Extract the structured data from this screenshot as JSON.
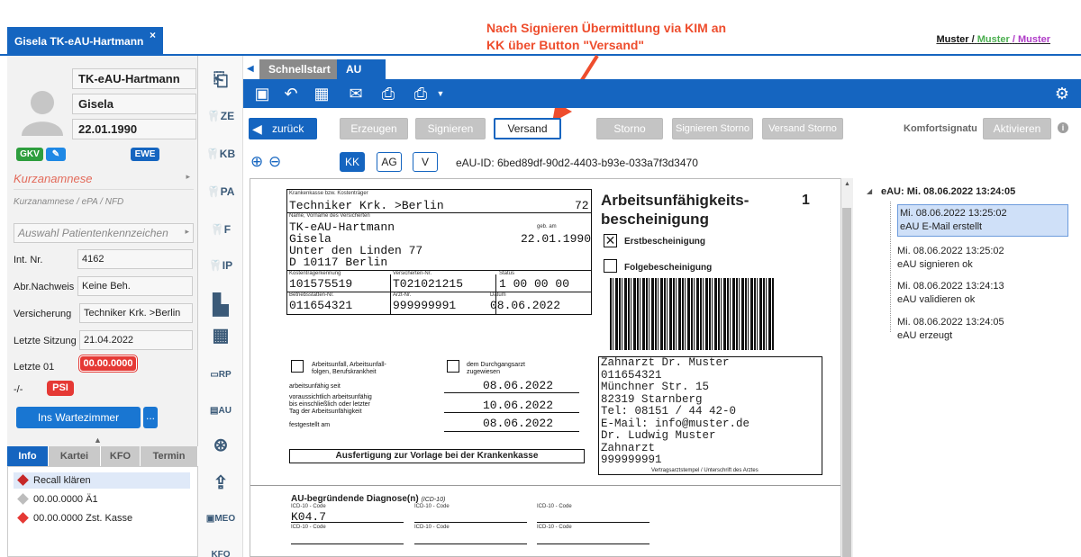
{
  "patient_tab": {
    "title": "Gisela TK-eAU-Hartmann",
    "close": "×"
  },
  "annotation": {
    "line1": "Nach Signieren Übermittlung via KIM an",
    "line2": "KK über Button \"Versand\""
  },
  "muster": {
    "a": "Muster",
    "sep1": "/",
    "b": "Muster",
    "sep2": "/",
    "c": "Muster"
  },
  "patient": {
    "lastname": "TK-eAU-Hartmann",
    "firstname": "Gisela",
    "birthdate": "22.01.1990",
    "badge_gkv": "GKV",
    "badge_ewe": "EWE",
    "kurzanamnese": "Kurzanamnese",
    "kurzanamnese_sub": "Kurzanamnese  /  ePA  /  NFD",
    "auswahl": "Auswahl Patientenkennzeichen",
    "fields": [
      {
        "label": "Int. Nr.",
        "value": "4162"
      },
      {
        "label": "Abr.Nachweis",
        "value": "Keine Beh."
      },
      {
        "label": "Versicherung",
        "value": "Techniker Krk. >Berlin"
      },
      {
        "label": "Letzte Sitzung",
        "value": "21.04.2022"
      }
    ],
    "letzte01_label": "Letzte 01",
    "letzte01_value": "00.00.0000",
    "psi_label": "-/-",
    "psi": "PSI",
    "wait_button": "Ins Wartezimmer",
    "wait_more": "..."
  },
  "left_tabs": [
    "Info",
    "Kartei",
    "KFO",
    "Termin"
  ],
  "tasks": [
    {
      "label": "Recall klären",
      "color": "#c62828"
    },
    {
      "label": "00.00.0000 Ä1",
      "color": "#bdbdbd"
    },
    {
      "label": "00.00.0000 Zst. Kasse",
      "color": "#e53935"
    }
  ],
  "icons": [
    "ZE",
    "KB",
    "PA",
    "F",
    "IP",
    "RP",
    "AU",
    "MEO",
    "KFO"
  ],
  "doc_tabs": {
    "schnellstart": "Schnellstart",
    "au": "AU",
    "close": "×"
  },
  "actions": {
    "zurueck": "zurück",
    "erzeugen": "Erzeugen",
    "signieren": "Signieren",
    "versand": "Versand",
    "storno": "Storno",
    "signieren_storno": "Signieren Storno",
    "versand_storno": "Versand Storno",
    "komfort": "Komfortsignatu",
    "aktivieren": "Aktivieren"
  },
  "recipients": [
    "KK",
    "AG",
    "V"
  ],
  "eau_id": "eAU-ID: 6bed89df-90d2-4403-b93e-033a7f3d3470",
  "form": {
    "l_kasse": "Krankenkasse bzw. Kostenträger",
    "kasse": "Techniker Krk. >Berlin",
    "kasse_nr": "72",
    "l_name": "Name, Vorname des Versicherten",
    "l_geb": "geb. am",
    "name1": "TK-eAU-Hartmann",
    "name2": "Gisela",
    "geb": "22.01.1990",
    "street": "Unter den Linden 77",
    "city": "D 10117 Berlin",
    "l_kt": "Kostenträgerkennung",
    "l_vnr": "Versicherten-Nr.",
    "l_status": "Status",
    "kt": "101575519",
    "vnr": "T021021215",
    "status": "1 00 00 00",
    "l_bs": "Betriebsstätten-Nr.",
    "l_arzt": "Arzt-Nr.",
    "l_datum": "Datum",
    "bs": "011654321",
    "arzt": "999999991",
    "datum": "08.06.2022",
    "title1": "Arbeitsunfähigkeits-",
    "title2": "bescheinigung",
    "page": "1",
    "erst": "Erstbescheinigung",
    "folge": "Folgebescheinigung",
    "unfall1": "Arbeitsunfall, Arbeitsunfall-",
    "unfall2": "folgen, Berufskrankheit",
    "durch1": "dem Durchgangsarzt",
    "durch2": "zugewiesen",
    "au_seit": "arbeitsunfähig seit",
    "au_seit_v": "08.06.2022",
    "vor1": "voraussichtlich arbeitsunfähig",
    "vor2": "bis einschließlich oder letzter",
    "vor3": "Tag der Arbeitsunfähigkeit",
    "vor_v": "10.06.2022",
    "fest": "festgestellt am",
    "fest_v": "08.06.2022",
    "ausfertigung": "Ausfertigung zur Vorlage bei der Krankenkasse",
    "arzt_lines": [
      "Zahnarzt Dr. Muster",
      "011654321",
      "Münchner Str.  15",
      "82319 Starnberg",
      "Tel: 08151 / 44 42-0",
      "E-Mail: info@muster.de",
      "Dr. Ludwig Muster",
      "Zahnarzt",
      "999999991"
    ],
    "stempel": "Vertragsarztstempel / Unterschrift des Arztes",
    "diag_title": "AU-begründende Diagnose(n)",
    "diag_sub": "(ICD-10)",
    "icd": "ICD-10 - Code",
    "icd_value": "K04.7"
  },
  "timeline": {
    "header": "eAU: Mi. 08.06.2022 13:24:05",
    "entries": [
      {
        "time": "Mi. 08.06.2022 13:25:02",
        "text": "eAU E-Mail erstellt"
      },
      {
        "time": "Mi. 08.06.2022 13:25:02",
        "text": "eAU signieren ok"
      },
      {
        "time": "Mi. 08.06.2022 13:24:13",
        "text": "eAU validieren ok"
      },
      {
        "time": "Mi. 08.06.2022 13:24:05",
        "text": "eAU erzeugt"
      }
    ]
  }
}
